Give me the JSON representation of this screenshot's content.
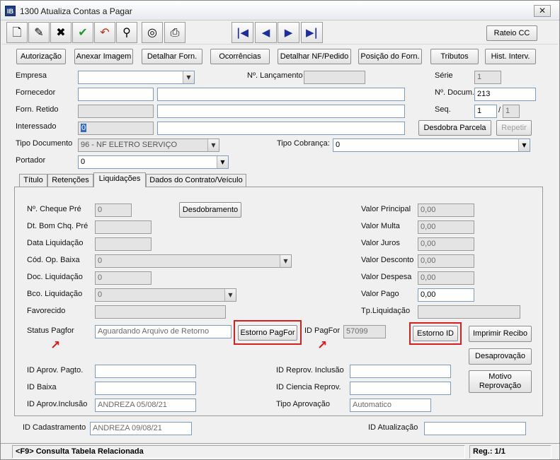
{
  "window": {
    "title": "1300 Atualiza Contas a Pagar",
    "app_icon_text": "IB",
    "close_label": "✕"
  },
  "toolbar": {
    "icons": [
      "new-document-icon",
      "edit-icon",
      "delete-icon",
      "confirm-icon",
      "undo-icon",
      "search-icon",
      "filter-icon",
      "print-icon"
    ],
    "nav": {
      "first": "|◀",
      "prev": "◀",
      "next": "▶",
      "last": "▶|"
    },
    "rateio_label": "Rateio CC"
  },
  "action_buttons": {
    "autorizacao": "Autorização",
    "anexar_imagem": "Anexar Imagem",
    "detalhar_forn": "Detalhar Forn.",
    "ocorrencias": "Ocorrências",
    "detalhar_nf": "Detalhar NF/Pedido",
    "posicao_forn": "Posição do Forn.",
    "tributos": "Tributos",
    "hist_interv": "Hist. Interv."
  },
  "header": {
    "empresa_label": "Empresa",
    "empresa_value": "",
    "lancamento_label": "Nº. Lançamento",
    "lancamento_value": "",
    "serie_label": "Série",
    "serie_value": "1",
    "fornecedor_label": "Fornecedor",
    "fornecedor_code": "",
    "fornecedor_name": "",
    "documento_label": "Nº. Docum.",
    "documento_value": "213",
    "forn_retido_label": "Forn. Retido",
    "forn_retido_code": "",
    "forn_retido_name": "",
    "seq_label": "Seq.",
    "seq_value": "1",
    "seq_sep": "/",
    "seq_total": "1",
    "interessado_label": "Interessado",
    "interessado_code": "0",
    "interessado_name": "",
    "desdobra_parcela": "Desdobra Parcela",
    "repetir": "Repetir",
    "tipo_documento_label": "Tipo Documento",
    "tipo_documento_value": "96 - NF ELETRO SERVIÇO",
    "tipo_cobranca_label": "Tipo Cobrança:",
    "tipo_cobranca_value": "0",
    "portador_label": "Portador",
    "portador_value": "0"
  },
  "tabs": [
    {
      "label": "Título"
    },
    {
      "label": "Retenções"
    },
    {
      "label": "Liquidações"
    },
    {
      "label": "Dados do Contrato/Veículo"
    }
  ],
  "liquidacoes": {
    "cheque_pre_label": "Nº. Cheque Pré",
    "cheque_pre_value": "0",
    "desdobramento": "Desdobramento",
    "dt_bom_label": "Dt. Bom Chq. Pré",
    "dt_bom_value": "",
    "data_liquidacao_label": "Data Liquidação",
    "data_liquidacao_value": "",
    "cod_op_baixa_label": "Cód. Op. Baixa",
    "cod_op_baixa_value": "0",
    "doc_liquidacao_label": "Doc. Liquidação",
    "doc_liquidacao_value": "0",
    "bco_liquidacao_label": "Bco. Liquidação",
    "bco_liquidacao_value": "0",
    "favorecido_label": "Favorecido",
    "favorecido_value": "",
    "status_pagfor_label": "Status Pagfor",
    "status_pagfor_value": "Aguardando Arquivo de Retorno",
    "estorno_pagfor": "Estorno PagFor",
    "id_pagfor_label": "ID PagFor",
    "id_pagfor_value": "57099",
    "estorno_id": "Estorno ID",
    "valor_principal_label": "Valor Principal",
    "valor_principal_value": "0,00",
    "valor_multa_label": "Valor Multa",
    "valor_multa_value": "0,00",
    "valor_juros_label": "Valor Juros",
    "valor_juros_value": "0,00",
    "valor_desconto_label": "Valor Desconto",
    "valor_desconto_value": "0,00",
    "valor_despesa_label": "Valor Despesa",
    "valor_despesa_value": "0,00",
    "valor_pago_label": "Valor Pago",
    "valor_pago_value": "0,00",
    "tp_liquidacao_label": "Tp.Liquidação",
    "tp_liquidacao_value": "",
    "imprimir_recibo": "Imprimir Recibo",
    "desaprovacao": "Desaprovação",
    "motivo_reprovacao_1": "Motivo",
    "motivo_reprovacao_2": "Reprovação",
    "id_aprov_pagto_label": "ID Aprov. Pagto.",
    "id_aprov_pagto_value": "",
    "id_reprov_inclusao_label": "ID Reprov. Inclusão",
    "id_reprov_inclusao_value": "",
    "id_baixa_label": "ID Baixa",
    "id_baixa_value": "",
    "id_ciencia_label": "ID Ciencia Reprov.",
    "id_ciencia_value": "",
    "id_aprov_inclusao_label": "ID Aprov.Inclusão",
    "id_aprov_inclusao_value": "ANDREZA 05/08/21",
    "tipo_aprovacao_label": "Tipo Aprovação",
    "tipo_aprovacao_value": "Automatico"
  },
  "footer": {
    "id_cadastramento_label": "ID Cadastramento",
    "id_cadastramento_value": "ANDREZA 09/08/21",
    "id_atualizacao_label": "ID Atualização",
    "id_atualizacao_value": ""
  },
  "statusbar": {
    "hint": "<F9> Consulta Tabela Relacionada",
    "record": "Reg.: 1/1"
  },
  "colors": {
    "highlight": "#d62020",
    "selection": "#3169c6",
    "nav_arrow": "#1d2f9e"
  }
}
